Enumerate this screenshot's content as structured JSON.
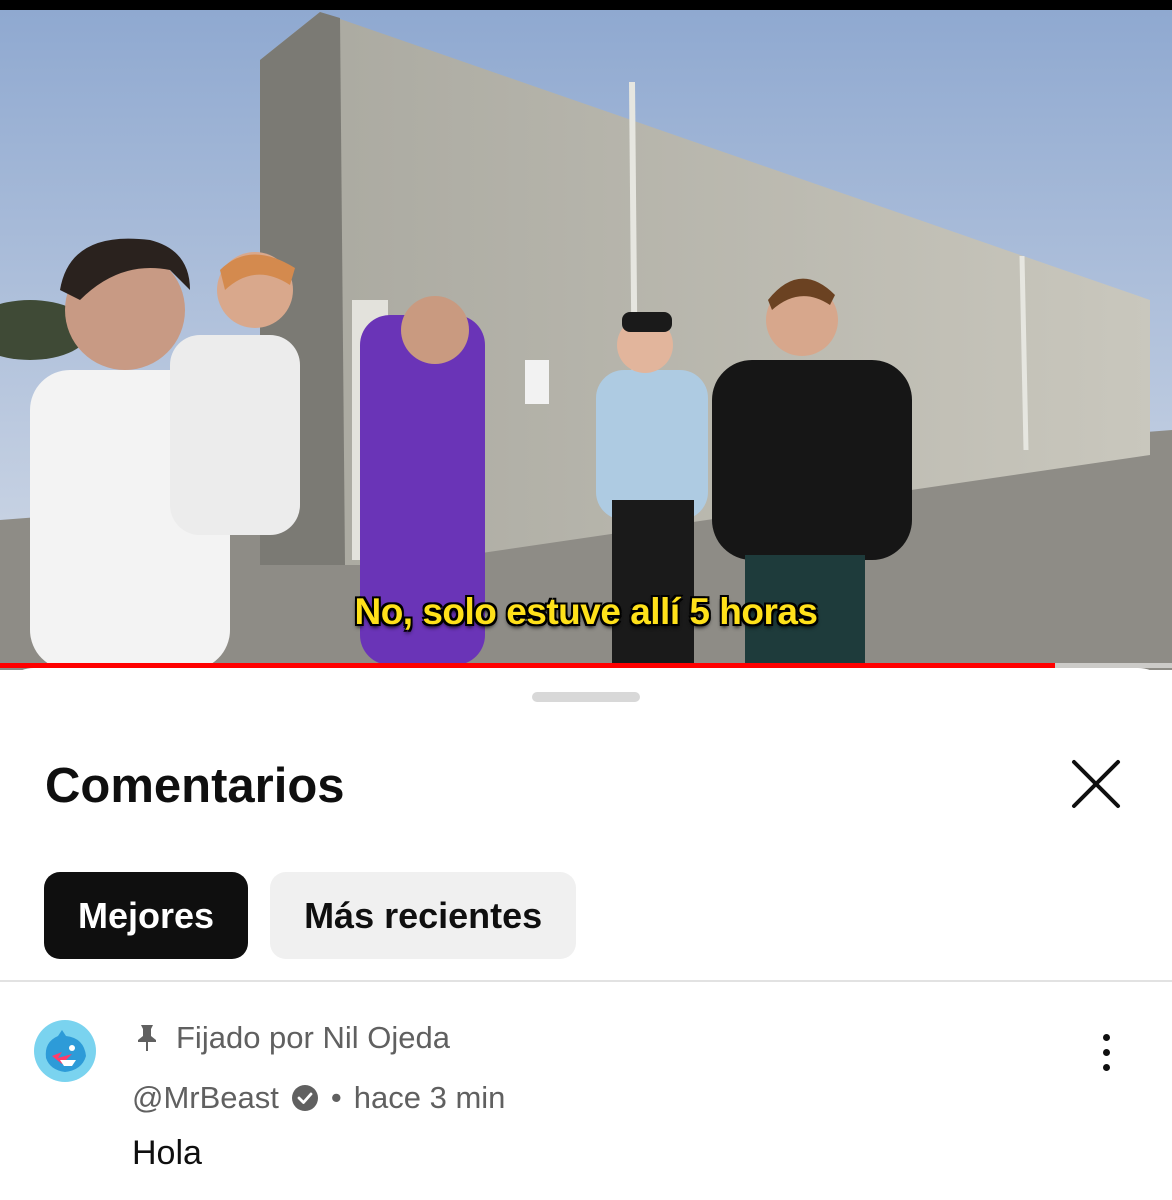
{
  "player": {
    "subtitle": "No, solo estuve allí 5 horas",
    "progress_fraction": 0.9,
    "colors": {
      "progress": "#ff0000",
      "subtitle": "#ffe11a"
    }
  },
  "comments_panel": {
    "title": "Comentarios",
    "close_icon": "close-icon",
    "filters": [
      {
        "label": "Mejores",
        "active": true
      },
      {
        "label": "Más recientes",
        "active": false
      }
    ],
    "pinned_comment": {
      "pinned_label": "Fijado por Nil Ojeda",
      "pin_icon": "pin-icon",
      "author": "@MrBeast",
      "verified_icon": "verified-check-icon",
      "separator": "•",
      "time": "hace 3 min",
      "text": "Hola",
      "menu_icon": "more-vertical-icon"
    }
  }
}
